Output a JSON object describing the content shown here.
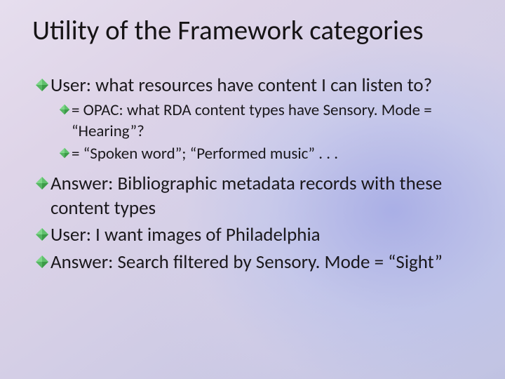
{
  "title": "Utility of the Framework categories",
  "bullets": {
    "b1": "User: what resources have content I can listen to?",
    "b1a": "= OPAC: what RDA content types have Sensory. Mode = “Hearing”?",
    "b1b": "= “Spoken word”; “Performed music” . . .",
    "b2": "Answer: Bibliographic metadata records with these content types",
    "b3": "User: I want images of Philadelphia",
    "b4": "Answer: Search filtered by Sensory. Mode = “Sight”"
  }
}
